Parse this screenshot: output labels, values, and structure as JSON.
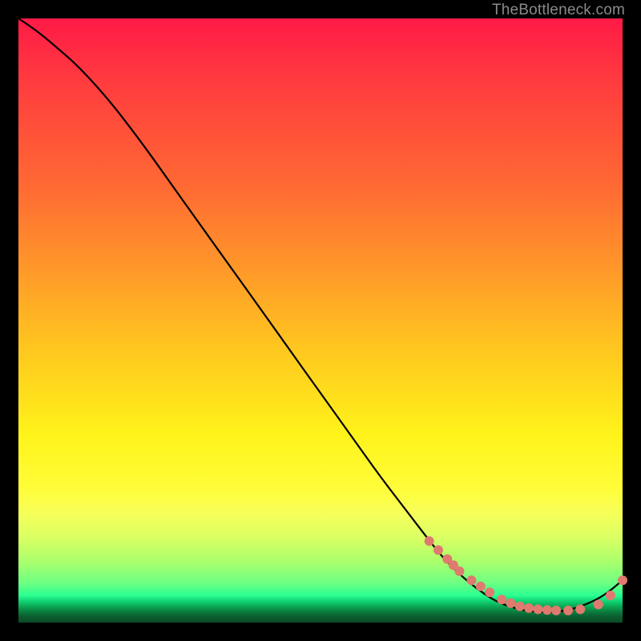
{
  "watermark": "TheBottleneck.com",
  "chart_data": {
    "type": "line",
    "title": "",
    "xlabel": "",
    "ylabel": "",
    "xlim": [
      0,
      100
    ],
    "ylim": [
      0,
      100
    ],
    "grid": false,
    "legend": false,
    "series": [
      {
        "name": "bottleneck-curve",
        "color": "#000000",
        "x": [
          0,
          3,
          6,
          10,
          15,
          20,
          25,
          30,
          35,
          40,
          45,
          50,
          55,
          60,
          65,
          70,
          73,
          76,
          79,
          82,
          85,
          88,
          91,
          94,
          97,
          100
        ],
        "y": [
          100,
          98,
          95.5,
          92,
          86.5,
          80,
          73,
          66,
          59,
          52,
          45,
          38,
          31,
          24,
          17.5,
          11,
          8,
          5.5,
          3.5,
          2.4,
          1.8,
          1.7,
          2.0,
          3.0,
          4.5,
          7
        ]
      }
    ],
    "markers": {
      "name": "salmon-dots",
      "color": "#e07a6f",
      "radius_px": 6,
      "x": [
        68,
        69.5,
        71,
        72,
        73,
        75,
        76.5,
        78,
        80,
        81.5,
        83,
        84.5,
        86,
        87.5,
        89,
        91,
        93,
        96,
        98,
        100
      ],
      "y": [
        13.5,
        12,
        10.5,
        9.5,
        8.5,
        7,
        6,
        5,
        3.8,
        3.2,
        2.7,
        2.4,
        2.2,
        2.1,
        2.0,
        2.0,
        2.2,
        3.0,
        4.5,
        7
      ]
    },
    "background_gradient": {
      "direction": "vertical",
      "stops": [
        {
          "pos": 0.0,
          "color": "#ff1a46"
        },
        {
          "pos": 0.3,
          "color": "#ff7a30"
        },
        {
          "pos": 0.55,
          "color": "#ffd820"
        },
        {
          "pos": 0.78,
          "color": "#fffd3a"
        },
        {
          "pos": 0.93,
          "color": "#6cff84"
        },
        {
          "pos": 0.96,
          "color": "#18e083"
        },
        {
          "pos": 1.0,
          "color": "#0a4a27"
        }
      ]
    }
  }
}
